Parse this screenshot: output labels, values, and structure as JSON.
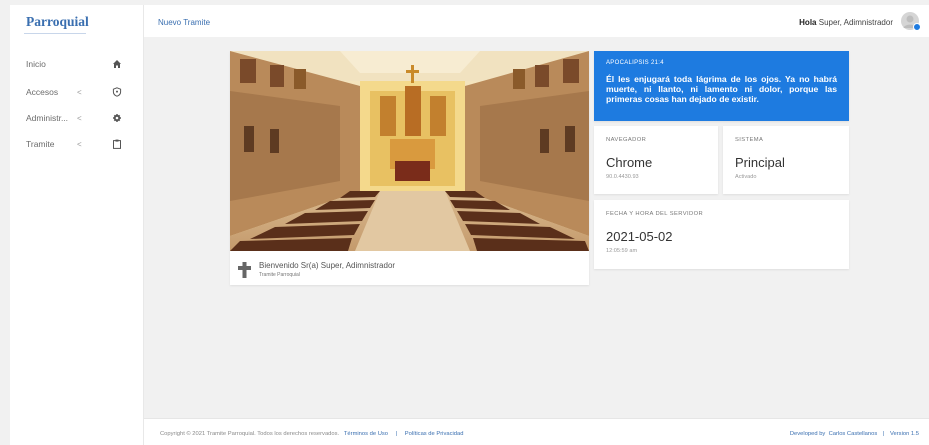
{
  "sidebar": {
    "brand": "Parroquial",
    "items": [
      {
        "label": "Inicio",
        "icon": "home-icon"
      },
      {
        "label": "Accesos",
        "chevron": "<",
        "icon": "shield-icon"
      },
      {
        "label": "Administr...",
        "chevron": "<",
        "icon": "gear-icon"
      },
      {
        "label": "Tramite",
        "chevron": "<",
        "icon": "clipboard-icon"
      }
    ]
  },
  "header": {
    "breadcrumb": "Nuevo Tramite",
    "greeting_bold": "Hola",
    "greeting_rest": "Super, Adimnistrador"
  },
  "church": {
    "welcome": "Bienvenido Sr(a) Super, Adimnistrador",
    "subtitle": "Tramite Parroquial"
  },
  "verse": {
    "reference": "APOCALIPSIS 21:4",
    "text": "Él les enjugará toda lágrima de los ojos. Ya no habrá muerte, ni llanto, ni lamento ni dolor, porque las primeras cosas han dejado de existir."
  },
  "browser": {
    "caption": "NAVEGADOR",
    "name": "Chrome",
    "version": "90.0.4430.93"
  },
  "system": {
    "caption": "SISTEMA",
    "name": "Principal",
    "status": "Activado"
  },
  "server_time": {
    "caption": "FECHA Y HORA DEL SERVIDOR",
    "date": "2021-05-02",
    "time": "12:05:59 am"
  },
  "footer": {
    "copyright": "Copyright © 2021 Tramite Parroquial. Todos los derechos reservados.",
    "terms": "Términos de Uso",
    "separator": "|",
    "privacy": "Políticas de Privacidad",
    "developed_by": "Developed by",
    "author": "Carlos Castellanos",
    "version": "Version 1.5"
  },
  "colors": {
    "accent": "#1e7be0",
    "brand": "#3a6fb0",
    "background": "#f1f1f1"
  }
}
